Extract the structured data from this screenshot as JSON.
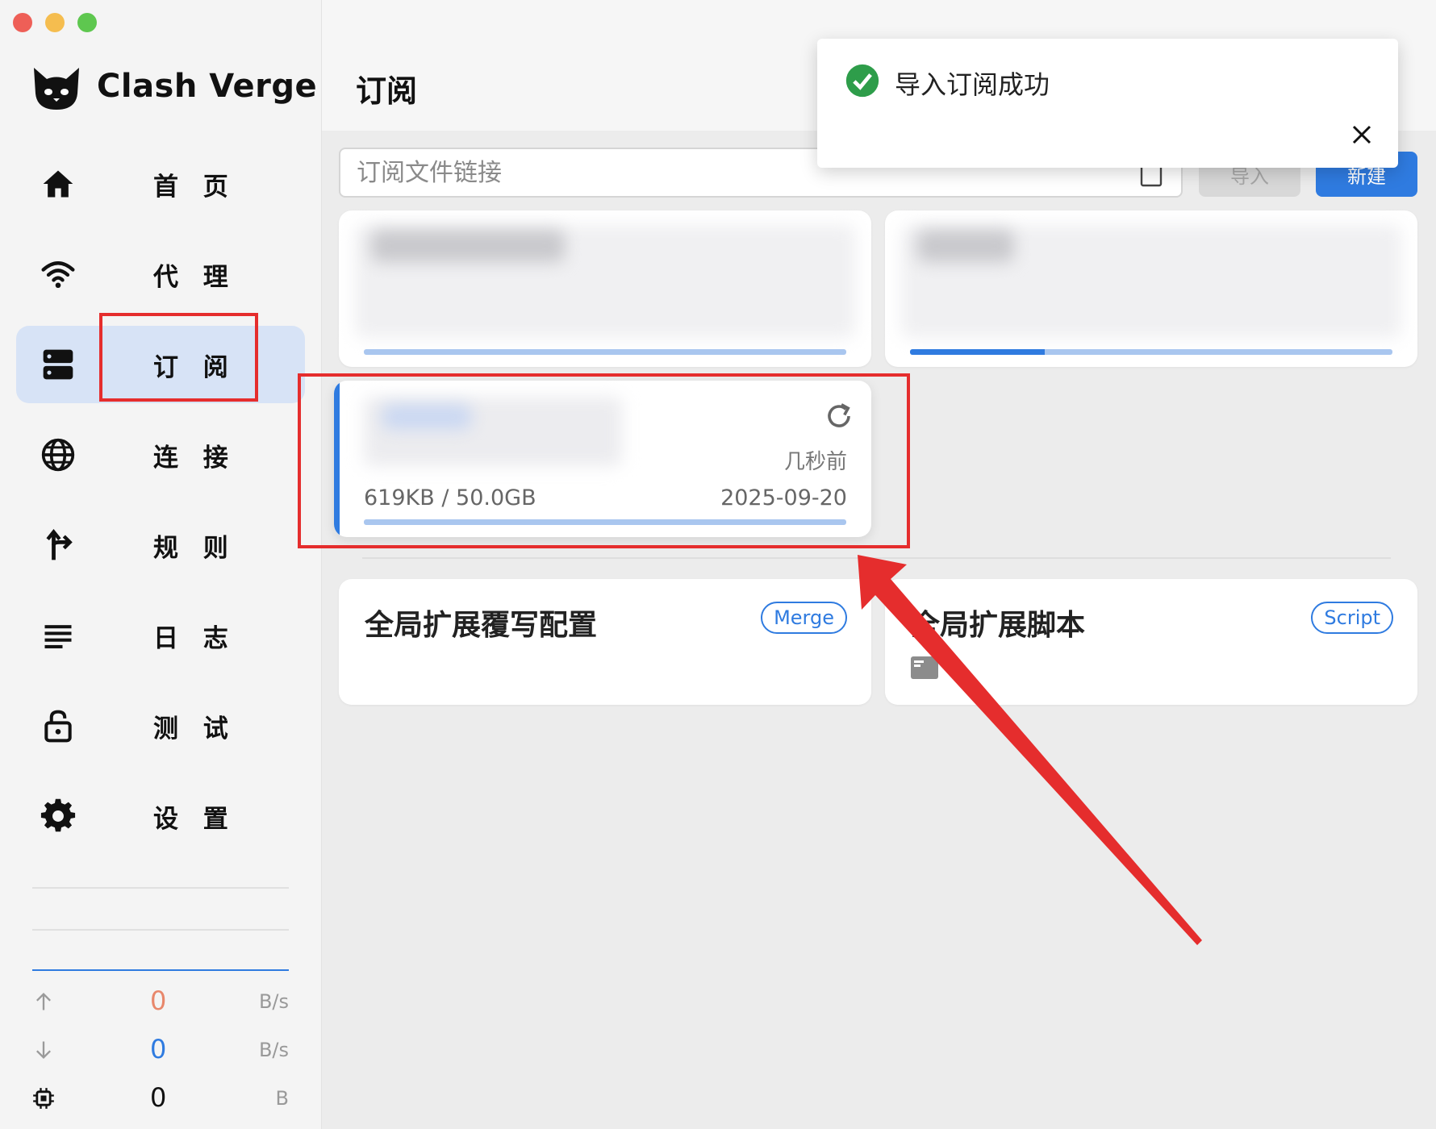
{
  "app": {
    "name": "Clash Verge"
  },
  "sidebar": {
    "items": [
      {
        "label": "首 页",
        "icon": "home-icon"
      },
      {
        "label": "代 理",
        "icon": "wifi-icon"
      },
      {
        "label": "订 阅",
        "icon": "server-icon",
        "active": true
      },
      {
        "label": "连 接",
        "icon": "globe-icon"
      },
      {
        "label": "规 则",
        "icon": "route-icon"
      },
      {
        "label": "日 志",
        "icon": "list-icon"
      },
      {
        "label": "测 试",
        "icon": "lock-open-icon"
      },
      {
        "label": "设 置",
        "icon": "gear-icon"
      }
    ],
    "traffic": {
      "upload": {
        "value": "0",
        "unit": "B/s",
        "color": "#e8876b"
      },
      "download": {
        "value": "0",
        "unit": "B/s",
        "color": "#2f7be0"
      },
      "memory": {
        "value": "0",
        "unit": "B",
        "color": "#111111"
      }
    }
  },
  "header": {
    "title": "订阅"
  },
  "toolbar": {
    "url_placeholder": "订阅文件链接",
    "url_value": "",
    "import_label": "导入",
    "new_label": "新建"
  },
  "profiles": [
    {
      "usage_fraction": 0.0
    },
    {
      "usage_fraction": 0.28
    },
    {
      "selected": true,
      "updated": "几秒前",
      "usage": "619KB / 50.0GB",
      "expire": "2025-09-20",
      "usage_fraction": 0.0
    }
  ],
  "extensions": [
    {
      "title": "全局扩展覆写配置",
      "badge": "Merge"
    },
    {
      "title": "全局扩展脚本",
      "badge": "Script"
    }
  ],
  "toast": {
    "message": "导入订阅成功",
    "status_color": "#2e9d4a"
  },
  "colors": {
    "accent": "#2f7be0",
    "annotation": "#e52d2d",
    "active_nav": "#d7e3f6"
  }
}
